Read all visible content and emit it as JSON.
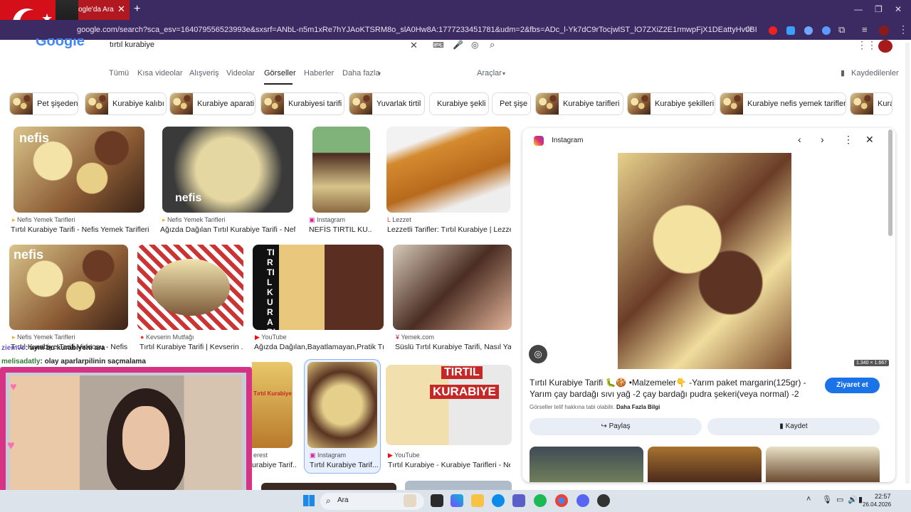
{
  "browser": {
    "tab_title": "ogle'da Ara",
    "url": "google.com/search?sca_esv=164079556523993e&sxsrf=ANbL-n5m1xRe7hYJAoKTSRM8o_slA0Hw8A:1777233451781&udm=2&fbs=ADc_l-Yk7dC9rTocjwlST_lO7ZXiZ2E1rmwpFjX1DEattyHv0BIGptfilf61p7IJzbSP0NUzlCRnT0qtn..."
  },
  "search": {
    "query": "tırtıl kurabiye"
  },
  "nav_tabs": [
    "Tümü",
    "Kısa videolar",
    "Alışveriş",
    "Videolar",
    "Görseller",
    "Haberler",
    "Daha fazla"
  ],
  "tools_label": "Araçlar",
  "saved_label": "Kaydedilenler",
  "chips": [
    "Pet şişeden",
    "Kurabiye kalıbı",
    "Kurabiye aparati",
    "Kurabiyesi tarifi",
    "Yuvarlak tirtil",
    "Kurabiye şekli",
    "Pet şişe",
    "Kurabiye tarifleri",
    "Kurabiye şekilleri",
    "Kurabiye nefis yemek tarifleri",
    "Kura"
  ],
  "results_row1": [
    {
      "source": "Nefis Yemek Tarifleri",
      "title": "Tırtıl Kurabiye Tarifi - Nefis Yemek Tarifleri"
    },
    {
      "source": "Nefis Yemek Tarifleri",
      "title": "Ağızda Dağılan Tırtıl Kurabiye Tarifi - Nefi..."
    },
    {
      "source": "Instagram",
      "title": "NEFİS TIRTIL KU..."
    },
    {
      "source": "Lezzet",
      "title": "Lezzetli Tarifler: Tırtıl Kurabiye | Lezzet"
    }
  ],
  "results_row2": [
    {
      "source": "Nefis Yemek Tarifleri",
      "title": "Tırtıl Kurabiye Tarifi Videosu - Nefis"
    },
    {
      "source": "Kevserin Mutfağı",
      "title": "Tırtıl Kurabiye Tarifi | Kevserin ..."
    },
    {
      "source": "YouTube",
      "title": "Ağızda Dağılan,Bayatlamayan,Pratik Tı..."
    },
    {
      "source": "Yemek.com",
      "title": "Süslü Tırtıl Kurabiye Tarifi, Nasıl Ya..."
    }
  ],
  "results_row3": [
    {
      "source": "erest",
      "title": "urabiye Tarif..."
    },
    {
      "source": "Instagram",
      "title": "Tırtıl Kurabiye Tarif..."
    },
    {
      "source": "YouTube",
      "title": "Tırtıl Kurabiye - Kurabiye Tarifleri - Ne..."
    }
  ],
  "overlay_texts": {
    "nefis": "nefis",
    "tirtil": "TIRTIL",
    "kurabiye": "KURABIYE",
    "tirtil_vertical": "TIRTIL KURABIYE",
    "tirtil_kurabiye_small": "Tırtıl Kurabiye"
  },
  "panel": {
    "source": "Instagram",
    "dims": "1.340 × 1.667",
    "title": "Tırtıl Kurabiye Tarifi 🐛🍪 •Malzemeler👇 -Yarım paket margarin(125gr) - Yarım çay bardağı sıvı yağ -2 çay bardağı pudra şekeri(veya normal) -2 ad...",
    "visit": "Ziyaret et",
    "copyright": "Görseller telif hakkına tabi olabilir.",
    "more_info": "Daha Fazla Bilgi",
    "share": "Paylaş",
    "save": "Kaydet"
  },
  "chat": [
    {
      "user": "ziemvo",
      "text": "ayni bu kurabiyeni ara"
    },
    {
      "user": "melisadatly",
      "text": "olay aparlarpilinin saçmalama"
    }
  ],
  "taskbar": {
    "search": "Ara",
    "time": "22:57",
    "date": "26.04.2026"
  },
  "colors": {
    "browser_bg": "#3c2a63",
    "accent": "#1a73e8"
  }
}
